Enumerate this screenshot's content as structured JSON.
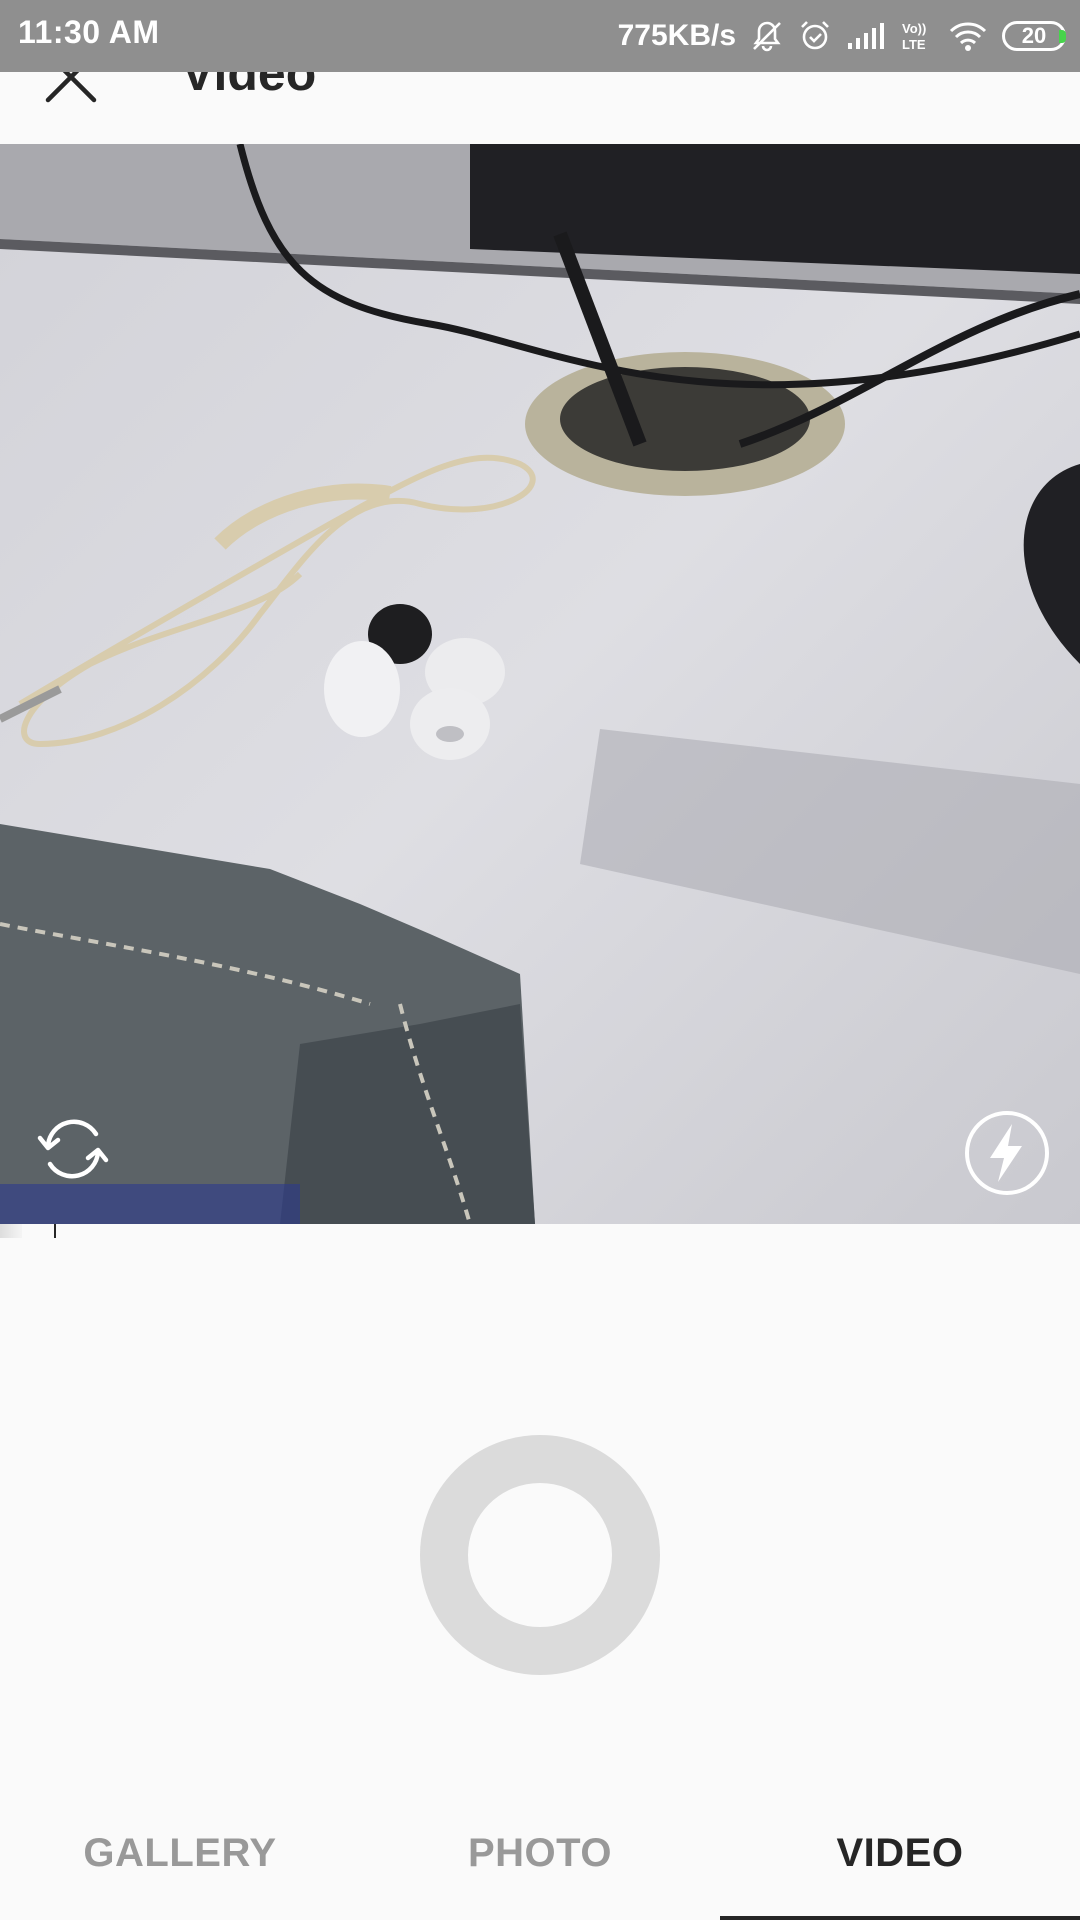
{
  "status_bar": {
    "time": "11:30 AM",
    "net_speed": "775KB/s",
    "volte_label": "Vo)) LTE",
    "battery_level": "20",
    "icons": [
      "mute-icon",
      "alarm-icon",
      "signal-icon",
      "volte-icon",
      "wifi-icon",
      "battery-icon"
    ]
  },
  "header": {
    "close_icon": "close-icon",
    "title": "Video"
  },
  "preview": {
    "switch_camera_icon": "switch-camera-icon",
    "flash_icon": "flash-icon"
  },
  "shutter": {
    "icon": "record-button"
  },
  "tabs": [
    {
      "label": "GALLERY",
      "active": false
    },
    {
      "label": "PHOTO",
      "active": false
    },
    {
      "label": "VIDEO",
      "active": true
    }
  ],
  "colors": {
    "status_bar_bg": "#8f8f8f",
    "background": "#fafafa",
    "text_primary": "#262626",
    "text_inactive": "#999999",
    "shutter_ring": "#dbdbdb",
    "battery_accent": "#47d44c"
  }
}
